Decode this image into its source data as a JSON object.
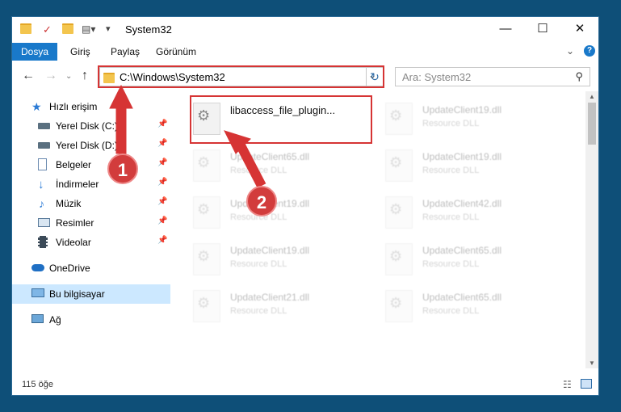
{
  "window": {
    "title": "System32",
    "minimize": "—",
    "maximize": "☐",
    "close": "✕"
  },
  "ribbon": {
    "tabs": [
      "Dosya",
      "Giriş",
      "Paylaş",
      "Görünüm"
    ],
    "expand": "⌄",
    "help": "?"
  },
  "address": {
    "path": "C:\\Windows\\System32",
    "search_placeholder": "Ara: System32"
  },
  "sidebar": {
    "items": [
      {
        "label": "Hızlı erişim",
        "icon": "star-icon"
      },
      {
        "label": "Yerel Disk (C:)",
        "icon": "drive-icon"
      },
      {
        "label": "Yerel Disk (D:)",
        "icon": "drive-icon"
      },
      {
        "label": "Belgeler",
        "icon": "documents-icon"
      },
      {
        "label": "İndirmeler",
        "icon": "download-icon"
      },
      {
        "label": "Müzik",
        "icon": "music-icon"
      },
      {
        "label": "Resimler",
        "icon": "pictures-icon"
      },
      {
        "label": "Videolar",
        "icon": "videos-icon"
      },
      {
        "label": "OneDrive",
        "icon": "cloud-icon"
      },
      {
        "label": "Bu bilgisayar",
        "icon": "computer-icon"
      },
      {
        "label": "Ağ",
        "icon": "network-icon"
      }
    ]
  },
  "files": {
    "highlighted": {
      "name": "libaccess_file_plugin...",
      "type": ""
    },
    "left_column": [
      {
        "name": "UpdateClient65.dll",
        "type": "Resource DLL"
      },
      {
        "name": "UpdateClient19.dll",
        "type": "Resource DLL"
      },
      {
        "name": "UpdateClient19.dll",
        "type": "Resource DLL"
      },
      {
        "name": "UpdateClient21.dll",
        "type": "Resource DLL"
      }
    ],
    "right_column": [
      {
        "name": "UpdateClient19.dll",
        "type": "Resource DLL"
      },
      {
        "name": "UpdateClient19.dll",
        "type": "Resource DLL"
      },
      {
        "name": "UpdateClient42.dll",
        "type": "Resource DLL"
      },
      {
        "name": "UpdateClient65.dll",
        "type": "Resource DLL"
      },
      {
        "name": "UpdateClient65.dll",
        "type": "Resource DLL"
      }
    ]
  },
  "status": {
    "count": "115 öğe"
  },
  "annotations": {
    "step1": "1",
    "step2": "2",
    "color": "#d63434"
  }
}
